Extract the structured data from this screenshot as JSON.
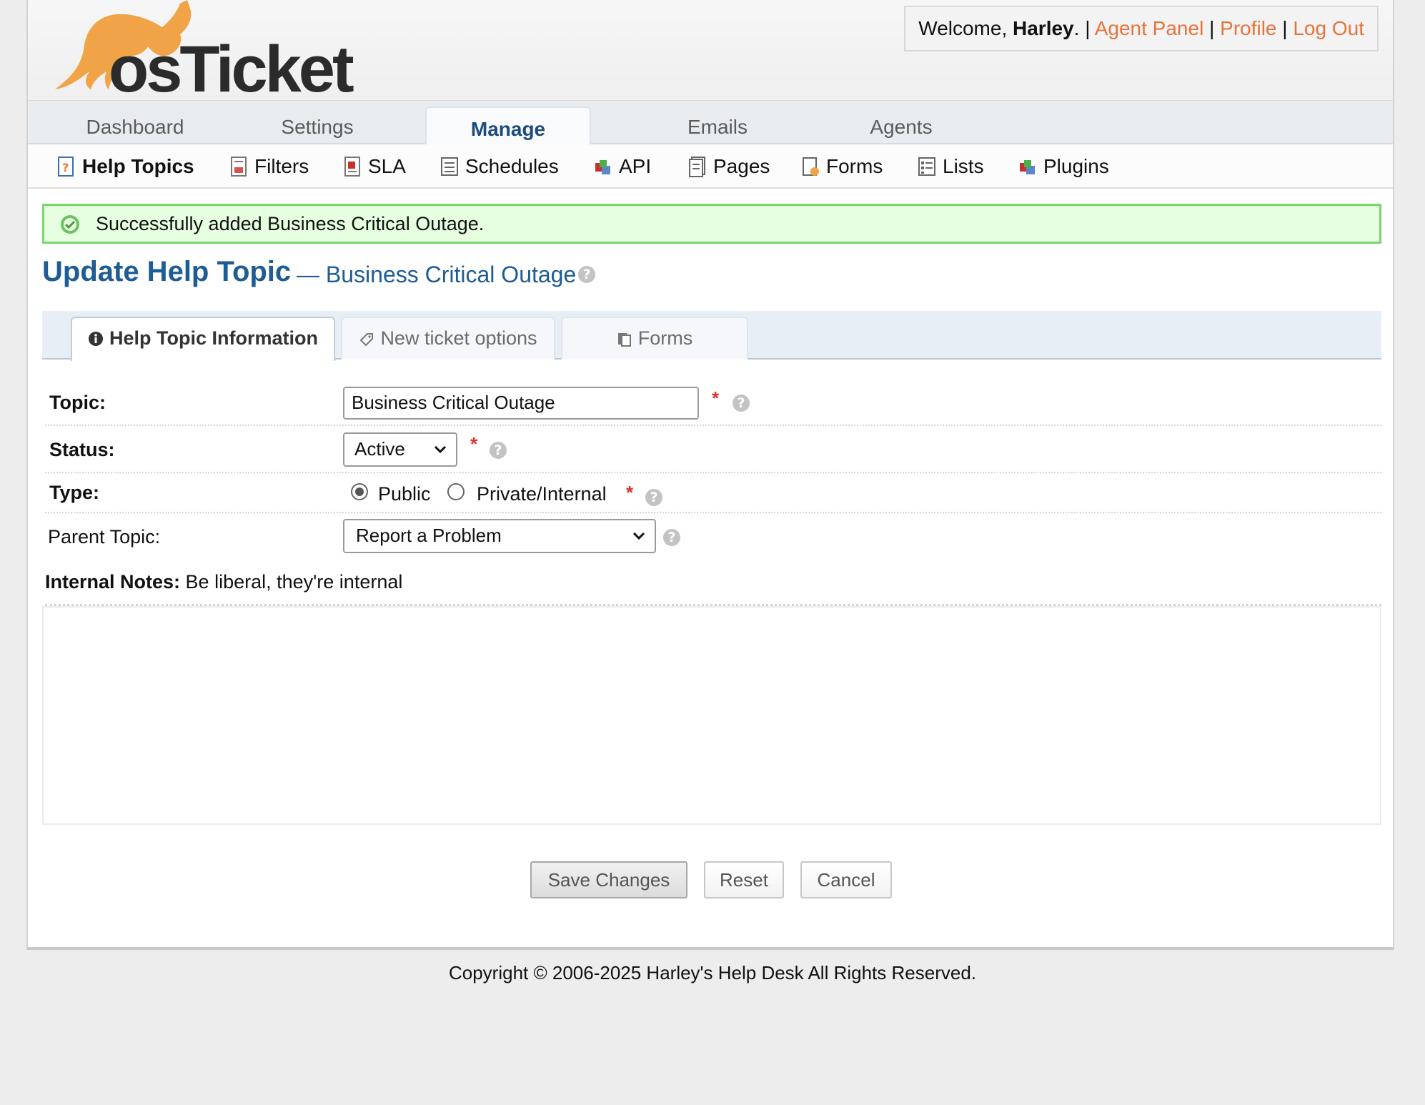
{
  "header": {
    "brand": "osTicket",
    "welcome_prefix": "Welcome,",
    "user_name": "Harley",
    "welcome_suffix": ". |",
    "links": {
      "agent_panel": "Agent Panel",
      "profile": "Profile",
      "log_out": "Log Out"
    },
    "separator": "|"
  },
  "nav": {
    "tabs": [
      {
        "label": "Dashboard",
        "active": false
      },
      {
        "label": "Settings",
        "active": false
      },
      {
        "label": "Manage",
        "active": true
      },
      {
        "label": "Emails",
        "active": false
      },
      {
        "label": "Agents",
        "active": false
      }
    ]
  },
  "subnav": {
    "items": [
      {
        "label": "Help Topics",
        "icon": "help-topics-icon",
        "active": true
      },
      {
        "label": "Filters",
        "icon": "filters-icon",
        "active": false
      },
      {
        "label": "SLA",
        "icon": "sla-icon",
        "active": false
      },
      {
        "label": "Schedules",
        "icon": "schedules-icon",
        "active": false
      },
      {
        "label": "API",
        "icon": "api-icon",
        "active": false
      },
      {
        "label": "Pages",
        "icon": "pages-icon",
        "active": false
      },
      {
        "label": "Forms",
        "icon": "forms-icon",
        "active": false
      },
      {
        "label": "Lists",
        "icon": "lists-icon",
        "active": false
      },
      {
        "label": "Plugins",
        "icon": "plugins-icon",
        "active": false
      }
    ]
  },
  "flash": {
    "message": "Successfully added Business Critical Outage.",
    "icon": "check-circle-icon"
  },
  "page": {
    "title": "Update Help Topic",
    "subtitle": "— Business Critical Outage",
    "help_glyph": "?"
  },
  "form_tabs": [
    {
      "label": "Help Topic Information",
      "icon": "info-icon",
      "active": true
    },
    {
      "label": "New ticket options",
      "icon": "tag-icon",
      "active": false
    },
    {
      "label": "Forms",
      "icon": "forms-doc-icon",
      "active": false
    }
  ],
  "form": {
    "topic": {
      "label": "Topic:",
      "value": "Business Critical Outage",
      "required": "*"
    },
    "status": {
      "label": "Status:",
      "value": "Active",
      "required": "*"
    },
    "type": {
      "label": "Type:",
      "options": [
        "Public",
        "Private/Internal"
      ],
      "selected": "Public",
      "required": "*"
    },
    "parent_topic": {
      "label": "Parent Topic:",
      "value": "Report a Problem"
    },
    "internal_notes": {
      "label": "Internal Notes:",
      "hint": "Be liberal, they're internal"
    }
  },
  "buttons": {
    "save": "Save Changes",
    "reset": "Reset",
    "cancel": "Cancel"
  },
  "footer": {
    "copyright": "Copyright © 2006-2025 Harley's Help Desk All Rights Reserved."
  },
  "colors": {
    "link": "#e8733a",
    "title": "#1d5c94",
    "success_bg": "#e6ffe0",
    "success_border": "#7bd56f",
    "required": "#e03030"
  }
}
